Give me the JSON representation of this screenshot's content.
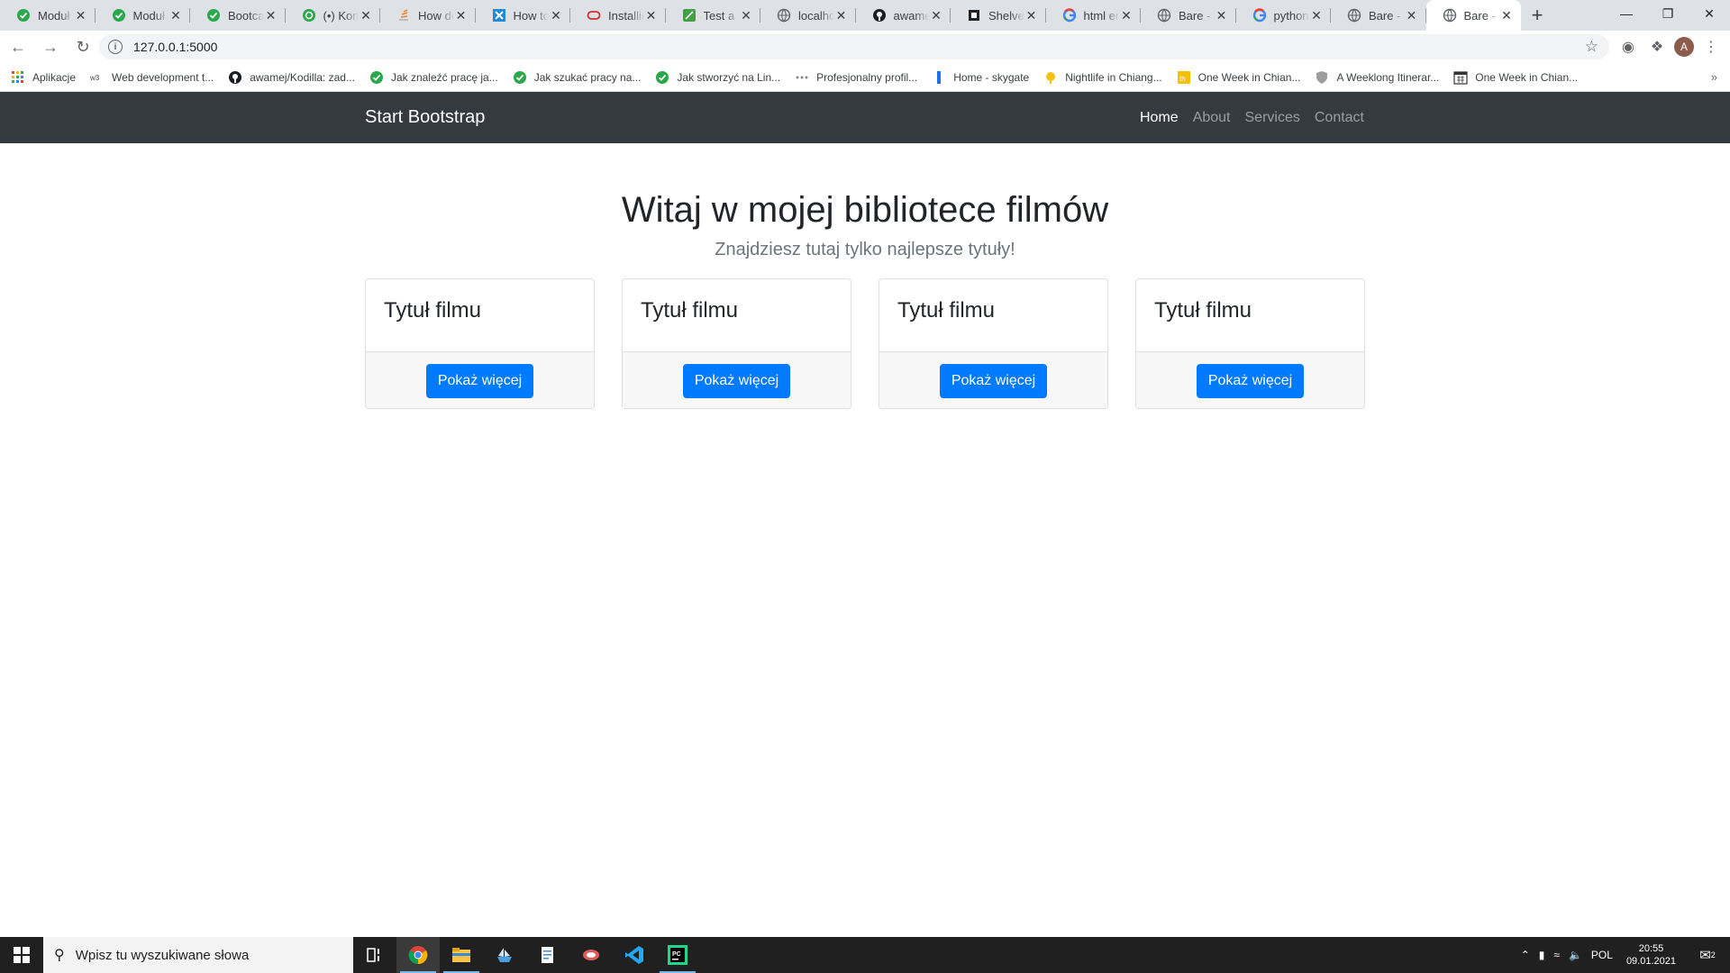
{
  "browser": {
    "tabs": [
      {
        "title": "Moduł",
        "favicon": "green-check-icon"
      },
      {
        "title": "Moduł",
        "favicon": "green-check-icon"
      },
      {
        "title": "Bootcam",
        "favicon": "green-check-icon"
      },
      {
        "title": "(•) Kom",
        "favicon": "green-refresh-icon"
      },
      {
        "title": "How do",
        "favicon": "stackoverflow-icon"
      },
      {
        "title": "How to",
        "favicon": "blue-x-icon"
      },
      {
        "title": "Installin",
        "favicon": "oracle-icon"
      },
      {
        "title": "Test a R",
        "favicon": "green-leaf-icon"
      },
      {
        "title": "localhos",
        "favicon": "globe-icon"
      },
      {
        "title": "awamej",
        "favicon": "github-icon"
      },
      {
        "title": "Shelve",
        "favicon": "book-icon"
      },
      {
        "title": "html en",
        "favicon": "google-icon"
      },
      {
        "title": "Bare - S",
        "favicon": "globe-icon"
      },
      {
        "title": "python",
        "favicon": "google-icon"
      },
      {
        "title": "Bare - S",
        "favicon": "globe-icon"
      },
      {
        "title": "Bare - S",
        "favicon": "globe-icon",
        "active": true
      }
    ],
    "new_tab_label": "+",
    "url": "127.0.0.1:5000",
    "avatar_letter": "A",
    "bookmarks": [
      {
        "label": "Aplikacje",
        "icon": "apps-grid-icon"
      },
      {
        "label": "Web development t...",
        "icon": "w3-icon"
      },
      {
        "label": "awamej/Kodilla: zad...",
        "icon": "github-icon"
      },
      {
        "label": "Jak znaleźć pracę ja...",
        "icon": "green-check-icon"
      },
      {
        "label": "Jak szukać pracy na...",
        "icon": "green-check-icon"
      },
      {
        "label": "Jak stworzyć na Lin...",
        "icon": "green-check-icon"
      },
      {
        "label": "Profesjonalny profil...",
        "icon": "dots-icon"
      },
      {
        "label": "Home - skygate",
        "icon": "blue-bar-icon"
      },
      {
        "label": "Nightlife in Chiang...",
        "icon": "yellow-pin-icon"
      },
      {
        "label": "One Week in Chian...",
        "icon": "yellow-th-icon"
      },
      {
        "label": "A Weeklong Itinerar...",
        "icon": "shield-icon"
      },
      {
        "label": "One Week in Chian...",
        "icon": "calendar-icon"
      }
    ],
    "bookmarks_more": "»"
  },
  "page": {
    "brand": "Start Bootstrap",
    "nav": [
      {
        "label": "Home",
        "active": true
      },
      {
        "label": "About",
        "active": false
      },
      {
        "label": "Services",
        "active": false
      },
      {
        "label": "Contact",
        "active": false
      }
    ],
    "heading": "Witaj w mojej bibliotece filmów",
    "subheading": "Znajdziesz tutaj tylko najlepsze tytuły!",
    "cards": [
      {
        "title": "Tytuł filmu",
        "button": "Pokaż więcej"
      },
      {
        "title": "Tytuł filmu",
        "button": "Pokaż więcej"
      },
      {
        "title": "Tytuł filmu",
        "button": "Pokaż więcej"
      },
      {
        "title": "Tytuł filmu",
        "button": "Pokaż więcej"
      }
    ],
    "colors": {
      "navbar": "#343a40",
      "primary": "#007bff"
    }
  },
  "taskbar": {
    "search_placeholder": "Wpisz tu wyszukiwane słowa",
    "apps": [
      "task-view-icon",
      "chrome-icon",
      "file-explorer-icon",
      "ship-app-icon",
      "notepad-icon",
      "snipping-icon",
      "vscode-icon",
      "pycharm-icon"
    ],
    "language": "POL",
    "time": "20:55",
    "date": "09.01.2021",
    "notifications": "2"
  }
}
